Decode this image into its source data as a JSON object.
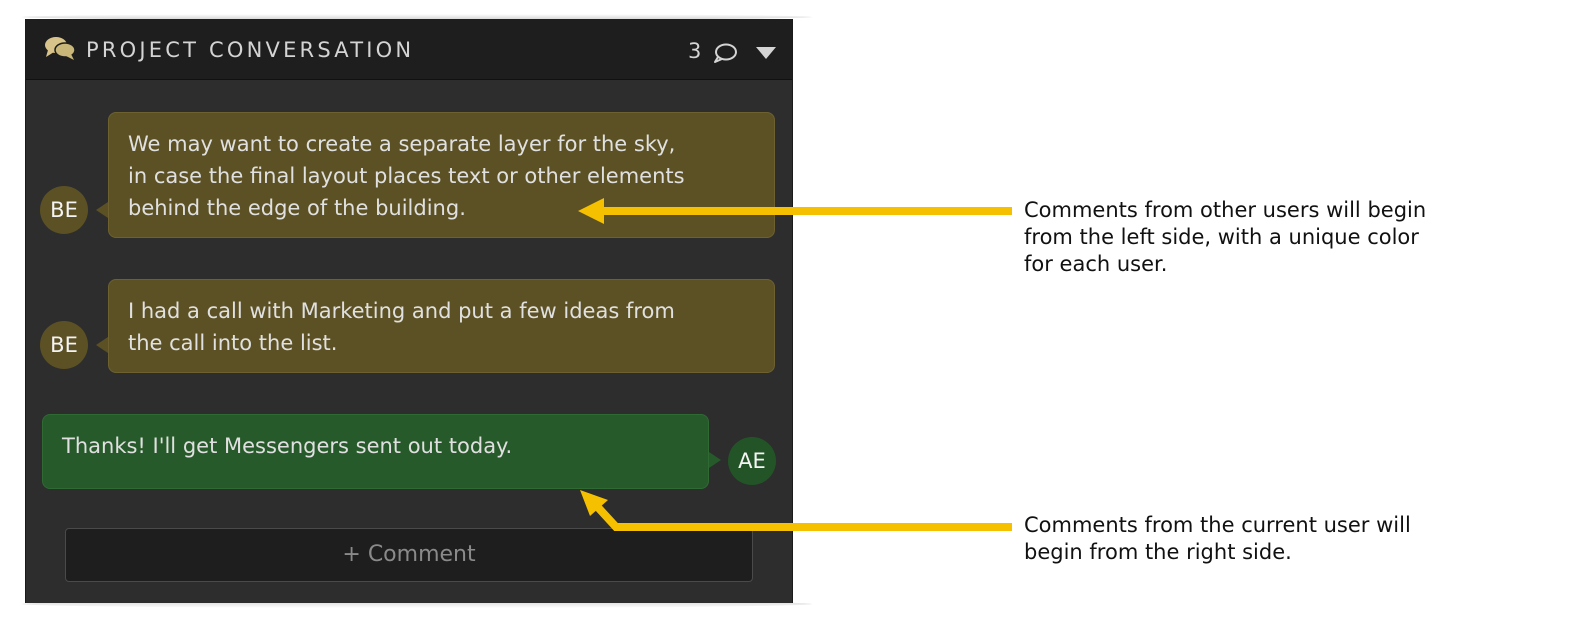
{
  "header": {
    "title": "PROJECT CONVERSATION",
    "comment_count": "3",
    "icon": "conversation-icon"
  },
  "comments": [
    {
      "initials": "BE",
      "author_type": "other",
      "lines": [
        "We may want to create a separate layer for the sky,",
        "in case the final layout places text or other elements",
        "behind the edge of the building."
      ]
    },
    {
      "initials": "BE",
      "author_type": "other",
      "lines": [
        "I had a call with Marketing and put a few ideas from",
        "the call into the list."
      ]
    },
    {
      "initials": "AE",
      "author_type": "self",
      "lines": [
        "Thanks! I'll get Messengers sent out today."
      ]
    }
  ],
  "add_comment_label": "+ Comment",
  "annotations": [
    {
      "lines": [
        "Comments from other users will begin",
        "from the left side, with a unique color",
        "for each user."
      ]
    },
    {
      "lines": [
        "Comments from the current user will",
        "begin from the right side."
      ]
    }
  ],
  "colors": {
    "panel_bg": "#2d2d2d",
    "header_bg": "#1e1e1e",
    "other_user": "#5c5124",
    "current_user": "#275a2a",
    "annotation_arrow": "#f5c000",
    "icon_gold": "#d8c48a"
  }
}
